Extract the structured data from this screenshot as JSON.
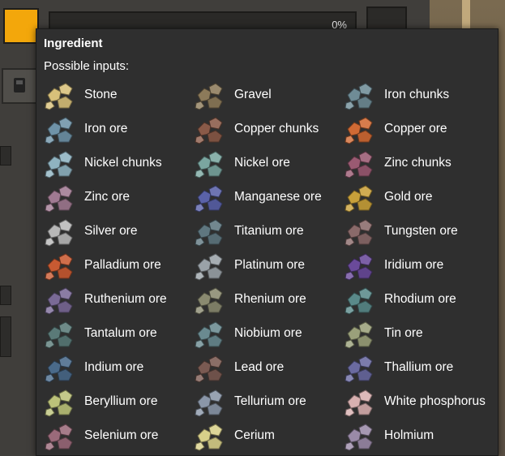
{
  "machine": {
    "progress_text": "0%"
  },
  "tooltip": {
    "title": "Ingredient",
    "subtitle": "Possible inputs:",
    "items": [
      {
        "label": "Stone",
        "icon": "stone-icon",
        "color": "#d8c07a"
      },
      {
        "label": "Gravel",
        "icon": "gravel-icon",
        "color": "#8c7a5a"
      },
      {
        "label": "Iron chunks",
        "icon": "iron-chunks-icon",
        "color": "#6f8c96"
      },
      {
        "label": "Iron ore",
        "icon": "iron-ore-icon",
        "color": "#6f93a8"
      },
      {
        "label": "Copper chunks",
        "icon": "copper-chunks-icon",
        "color": "#8a5a48"
      },
      {
        "label": "Copper ore",
        "icon": "copper-ore-icon",
        "color": "#d06a34"
      },
      {
        "label": "Nickel chunks",
        "icon": "nickel-chunks-icon",
        "color": "#8fb3c0"
      },
      {
        "label": "Nickel ore",
        "icon": "nickel-ore-icon",
        "color": "#7aa6a0"
      },
      {
        "label": "Zinc chunks",
        "icon": "zinc-chunks-icon",
        "color": "#9a5a72"
      },
      {
        "label": "Zinc ore",
        "icon": "zinc-ore-icon",
        "color": "#a07a92"
      },
      {
        "label": "Manganese ore",
        "icon": "manganese-ore-icon",
        "color": "#5a62a8"
      },
      {
        "label": "Gold ore",
        "icon": "gold-ore-icon",
        "color": "#c8a03a"
      },
      {
        "label": "Silver ore",
        "icon": "silver-ore-icon",
        "color": "#b8b8b8"
      },
      {
        "label": "Titanium ore",
        "icon": "titanium-ore-icon",
        "color": "#5f7780"
      },
      {
        "label": "Tungsten ore",
        "icon": "tungsten-ore-icon",
        "color": "#8a6a6a"
      },
      {
        "label": "Palladium ore",
        "icon": "palladium-ore-icon",
        "color": "#c85a32"
      },
      {
        "label": "Platinum ore",
        "icon": "platinum-ore-icon",
        "color": "#9aa2a8"
      },
      {
        "label": "Iridium ore",
        "icon": "iridium-ore-icon",
        "color": "#6a4a9a"
      },
      {
        "label": "Ruthenium ore",
        "icon": "ruthenium-ore-icon",
        "color": "#7a6a96"
      },
      {
        "label": "Rhenium ore",
        "icon": "rhenium-ore-icon",
        "color": "#8a8a70"
      },
      {
        "label": "Rhodium ore",
        "icon": "rhodium-ore-icon",
        "color": "#5a8a8a"
      },
      {
        "label": "Tantalum ore",
        "icon": "tantalum-ore-icon",
        "color": "#5a7a78"
      },
      {
        "label": "Niobium ore",
        "icon": "niobium-ore-icon",
        "color": "#6a8a90"
      },
      {
        "label": "Tin ore",
        "icon": "tin-ore-icon",
        "color": "#9aa07a"
      },
      {
        "label": "Indium ore",
        "icon": "indium-ore-icon",
        "color": "#4a6a8a"
      },
      {
        "label": "Lead ore",
        "icon": "lead-ore-icon",
        "color": "#7a5a52"
      },
      {
        "label": "Thallium ore",
        "icon": "thallium-ore-icon",
        "color": "#6a6aa0"
      },
      {
        "label": "Beryllium ore",
        "icon": "beryllium-ore-icon",
        "color": "#bcc27a"
      },
      {
        "label": "Tellurium ore",
        "icon": "tellurium-ore-icon",
        "color": "#8a96a8"
      },
      {
        "label": "White phosphorus",
        "icon": "white-phosphorus-icon",
        "color": "#d8b0b0"
      },
      {
        "label": "Selenium ore",
        "icon": "selenium-ore-icon",
        "color": "#9a6a7a"
      },
      {
        "label": "Cerium",
        "icon": "cerium-icon",
        "color": "#d8d08a"
      },
      {
        "label": "Holmium",
        "icon": "holmium-icon",
        "color": "#9a8aa8"
      }
    ]
  }
}
